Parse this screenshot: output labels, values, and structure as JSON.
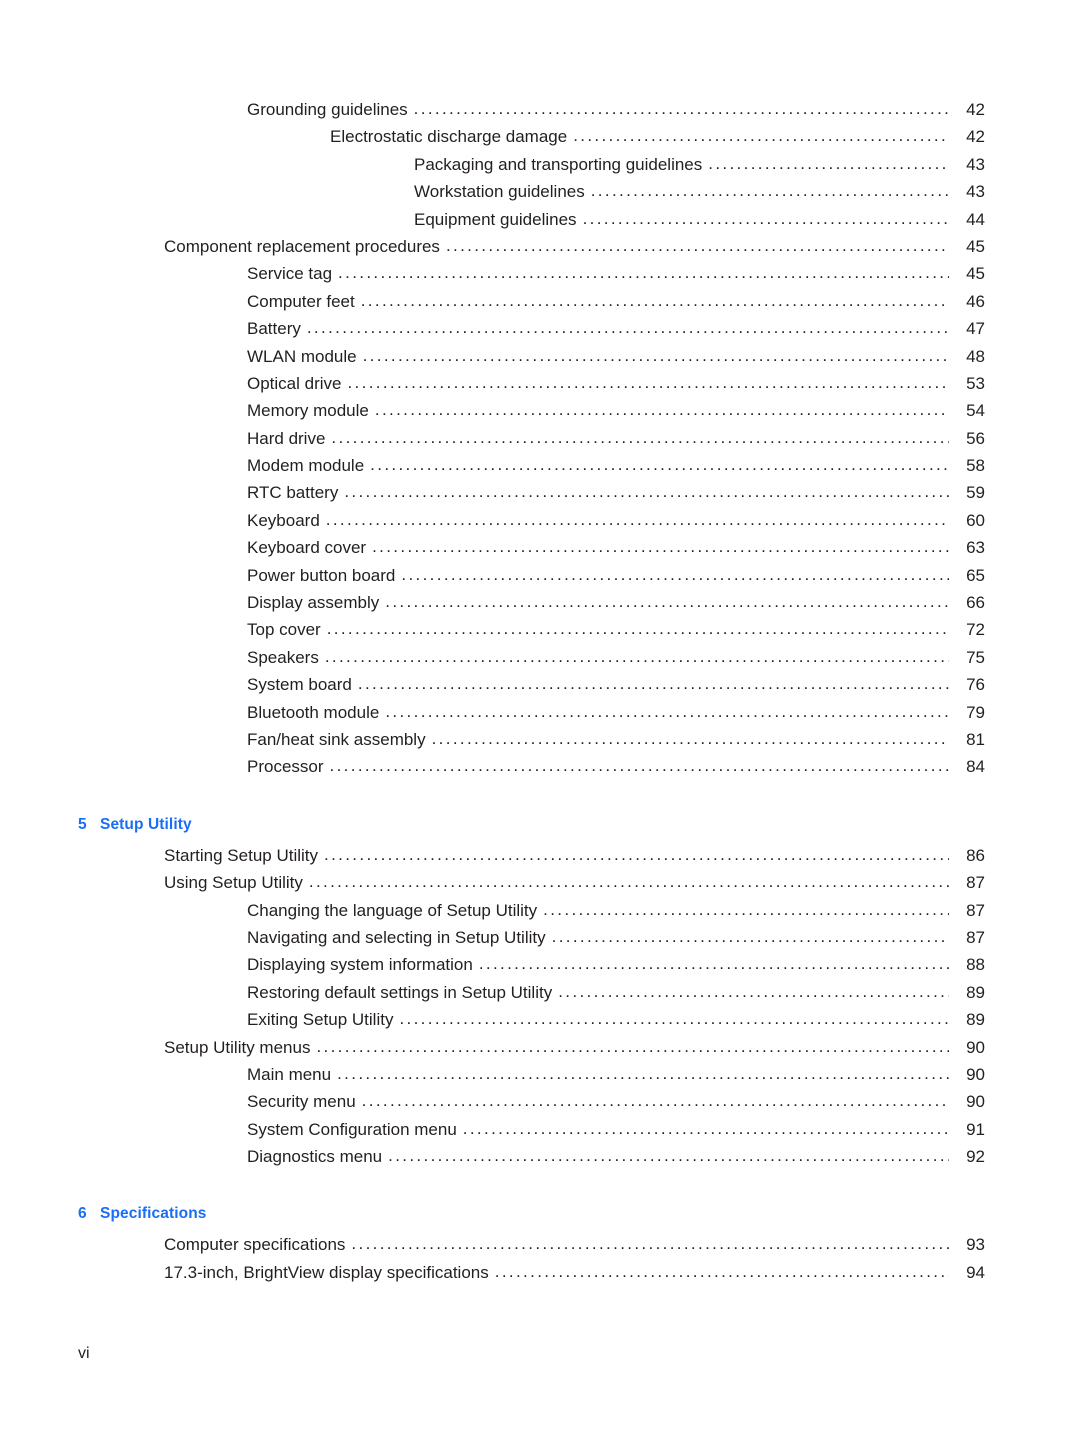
{
  "document": {
    "type": "table-of-contents",
    "folio": "vi",
    "accent_color": "#1a6ef5",
    "text_color": "#231f20"
  },
  "blocks": [
    {
      "kind": "entries",
      "entries": [
        {
          "label": "Grounding guidelines",
          "page": "42",
          "level": 2
        },
        {
          "label": "Electrostatic discharge damage",
          "page": "42",
          "level": 3
        },
        {
          "label": "Packaging and transporting guidelines",
          "page": "43",
          "level": 4
        },
        {
          "label": "Workstation guidelines",
          "page": "43",
          "level": 4
        },
        {
          "label": "Equipment guidelines",
          "page": "44",
          "level": 4
        },
        {
          "label": "Component replacement procedures",
          "page": "45",
          "level": 1
        },
        {
          "label": "Service tag",
          "page": "45",
          "level": 2
        },
        {
          "label": "Computer feet",
          "page": "46",
          "level": 2
        },
        {
          "label": "Battery",
          "page": "47",
          "level": 2
        },
        {
          "label": "WLAN module",
          "page": "48",
          "level": 2
        },
        {
          "label": "Optical drive",
          "page": "53",
          "level": 2
        },
        {
          "label": "Memory module",
          "page": "54",
          "level": 2
        },
        {
          "label": "Hard drive",
          "page": "56",
          "level": 2
        },
        {
          "label": "Modem module",
          "page": "58",
          "level": 2
        },
        {
          "label": "RTC battery",
          "page": "59",
          "level": 2
        },
        {
          "label": "Keyboard",
          "page": "60",
          "level": 2
        },
        {
          "label": "Keyboard cover",
          "page": "63",
          "level": 2
        },
        {
          "label": "Power button board",
          "page": "65",
          "level": 2
        },
        {
          "label": "Display assembly",
          "page": "66",
          "level": 2
        },
        {
          "label": "Top cover",
          "page": "72",
          "level": 2
        },
        {
          "label": "Speakers",
          "page": "75",
          "level": 2
        },
        {
          "label": "System board",
          "page": "76",
          "level": 2
        },
        {
          "label": "Bluetooth module",
          "page": "79",
          "level": 2
        },
        {
          "label": "Fan/heat sink assembly",
          "page": "81",
          "level": 2
        },
        {
          "label": "Processor",
          "page": "84",
          "level": 2
        }
      ]
    },
    {
      "kind": "chapter",
      "number": "5",
      "title": "Setup Utility",
      "entries": [
        {
          "label": "Starting Setup Utility",
          "page": "86",
          "level": 1
        },
        {
          "label": "Using Setup Utility",
          "page": "87",
          "level": 1
        },
        {
          "label": "Changing the language of Setup Utility",
          "page": "87",
          "level": 2
        },
        {
          "label": "Navigating and selecting in Setup Utility",
          "page": "87",
          "level": 2
        },
        {
          "label": "Displaying system information",
          "page": "88",
          "level": 2
        },
        {
          "label": "Restoring default settings in Setup Utility",
          "page": "89",
          "level": 2
        },
        {
          "label": "Exiting Setup Utility",
          "page": "89",
          "level": 2
        },
        {
          "label": "Setup Utility menus",
          "page": "90",
          "level": 1
        },
        {
          "label": "Main menu",
          "page": "90",
          "level": 2
        },
        {
          "label": "Security menu",
          "page": "90",
          "level": 2
        },
        {
          "label": "System Configuration menu",
          "page": "91",
          "level": 2
        },
        {
          "label": "Diagnostics menu",
          "page": "92",
          "level": 2
        }
      ]
    },
    {
      "kind": "chapter",
      "number": "6",
      "title": "Specifications",
      "entries": [
        {
          "label": "Computer specifications",
          "page": "93",
          "level": 1
        },
        {
          "label": "17.3-inch, BrightView display specifications",
          "page": "94",
          "level": 1
        }
      ]
    }
  ]
}
